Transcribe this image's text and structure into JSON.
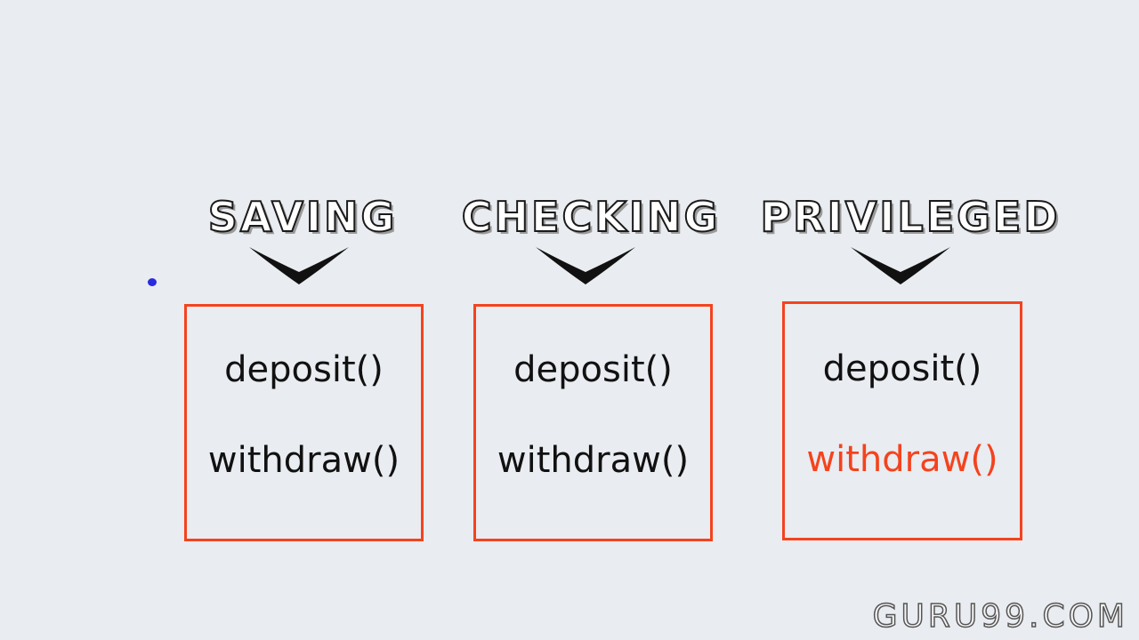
{
  "classes": [
    {
      "title": "SAVING",
      "methods": [
        "deposit()",
        "withdraw()"
      ]
    },
    {
      "title": "CHECKING",
      "methods": [
        "deposit()",
        "withdraw()"
      ]
    },
    {
      "title": "PRIVILEGED",
      "methods": [
        "deposit()",
        "withdraw()"
      ],
      "highlighted_method": "withdraw()"
    }
  ],
  "colors": {
    "box_border": "#f4431e",
    "highlight_text": "#f4431e",
    "method_text": "#111111",
    "background": "#e9ecf0"
  },
  "watermark": "GURU99.COM"
}
